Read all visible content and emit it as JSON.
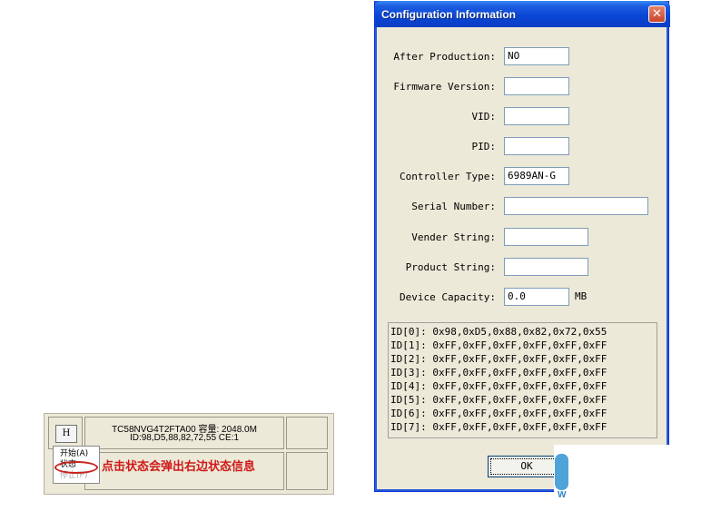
{
  "device_panel": {
    "h_button": "H",
    "model_line": "TC58NVG4T2FTA00 容量: 2048.0M",
    "id_line": "ID:98,D5,88,82,72,55 CE:1"
  },
  "context_menu": {
    "items": [
      {
        "label": "开始(A)",
        "enabled": true
      },
      {
        "label": "状态",
        "enabled": true
      },
      {
        "label": "停止(P)",
        "enabled": false
      }
    ]
  },
  "annotation": {
    "text": "点击状态会弹出右边状态信息",
    "color": "#d01818"
  },
  "dialog": {
    "title": "Configuration Information",
    "close_glyph": "✕",
    "fields": [
      {
        "label": "After Production:",
        "value": "NO"
      },
      {
        "label": "Firmware Version:",
        "value": ""
      },
      {
        "label": "VID:",
        "value": ""
      },
      {
        "label": "PID:",
        "value": ""
      },
      {
        "label": "Controller Type:",
        "value": "6989AN-G"
      },
      {
        "label": "Serial Number:",
        "value": ""
      },
      {
        "label": "Vender String:",
        "value": ""
      },
      {
        "label": "Product String:",
        "value": ""
      },
      {
        "label": "Device Capacity:",
        "value": "0.0",
        "unit": "MB"
      }
    ],
    "id_lines": [
      "ID[0]: 0x98,0xD5,0x88,0x82,0x72,0x55",
      "ID[1]: 0xFF,0xFF,0xFF,0xFF,0xFF,0xFF",
      "ID[2]: 0xFF,0xFF,0xFF,0xFF,0xFF,0xFF",
      "ID[3]: 0xFF,0xFF,0xFF,0xFF,0xFF,0xFF",
      "ID[4]: 0xFF,0xFF,0xFF,0xFF,0xFF,0xFF",
      "ID[5]: 0xFF,0xFF,0xFF,0xFF,0xFF,0xFF",
      "ID[6]: 0xFF,0xFF,0xFF,0xFF,0xFF,0xFF",
      "ID[7]: 0xFF,0xFF,0xFF,0xFF,0xFF,0xFF"
    ],
    "ok_label": "OK"
  },
  "watermark": {
    "letter": "W"
  }
}
